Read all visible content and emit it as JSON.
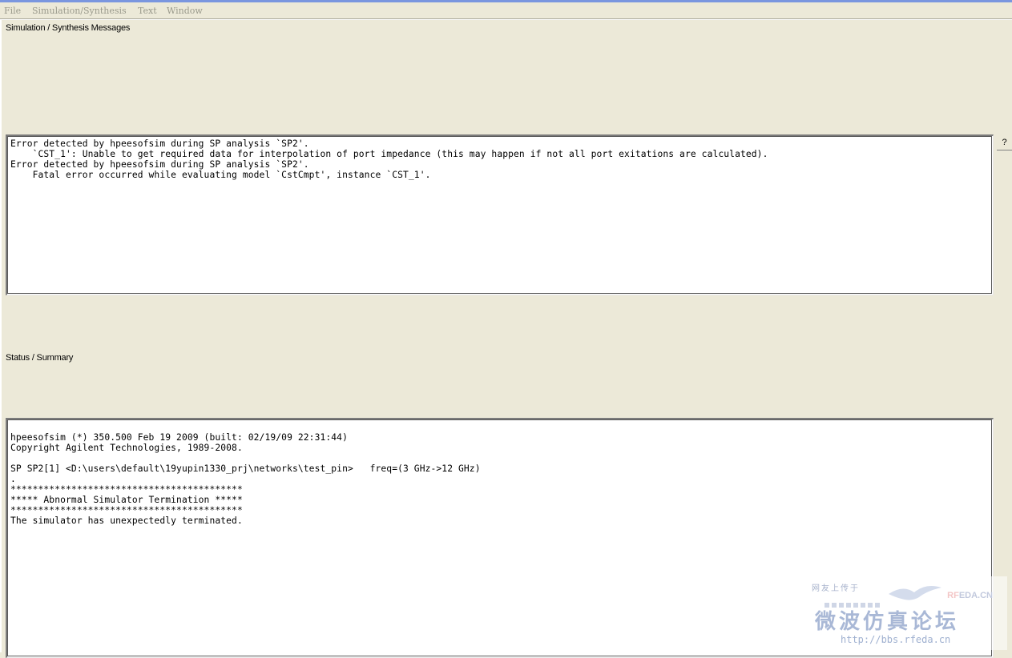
{
  "menubar": {
    "items": [
      {
        "label": "File"
      },
      {
        "label": "Simulation/Synthesis"
      },
      {
        "label": "Text"
      },
      {
        "label": "Window"
      }
    ]
  },
  "messages_panel": {
    "label": "Simulation / Synthesis Messages",
    "lines": [
      "Error detected by hpeesofsim during SP analysis `SP2'.",
      "    `CST_1': Unable to get required data for interpolation of port impedance (this may happen if not all port exitations are calculated).",
      "Error detected by hpeesofsim during SP analysis `SP2'.",
      "    Fatal error occurred while evaluating model `CstCmpt', instance `CST_1'."
    ]
  },
  "help_button": {
    "label": "?"
  },
  "status_panel": {
    "label": "Status / Summary",
    "lines": [
      "",
      "hpeesofsim (*) 350.500 Feb 19 2009 (built: 02/19/09 22:31:44)",
      "Copyright Agilent Technologies, 1989-2008.",
      "",
      "SP SP2[1] <D:\\users\\default\\19yupin1330_prj\\networks\\test_pin>   freq=(3 GHz->12 GHz)",
      ".",
      "******************************************",
      "***** Abnormal Simulator Termination *****",
      "******************************************",
      "The simulator has unexpectedly terminated."
    ]
  },
  "watermark": {
    "small_text": "网友上传于",
    "brand_rf": "RF",
    "brand_rest": "EDA.CN",
    "big_text": "微波仿真论坛",
    "url": "http://bbs.rfeda.cn"
  },
  "colors": {
    "window_bg": "#ece9d8",
    "text_bg": "#ffffff",
    "menu_disabled": "#9a9a8c"
  }
}
